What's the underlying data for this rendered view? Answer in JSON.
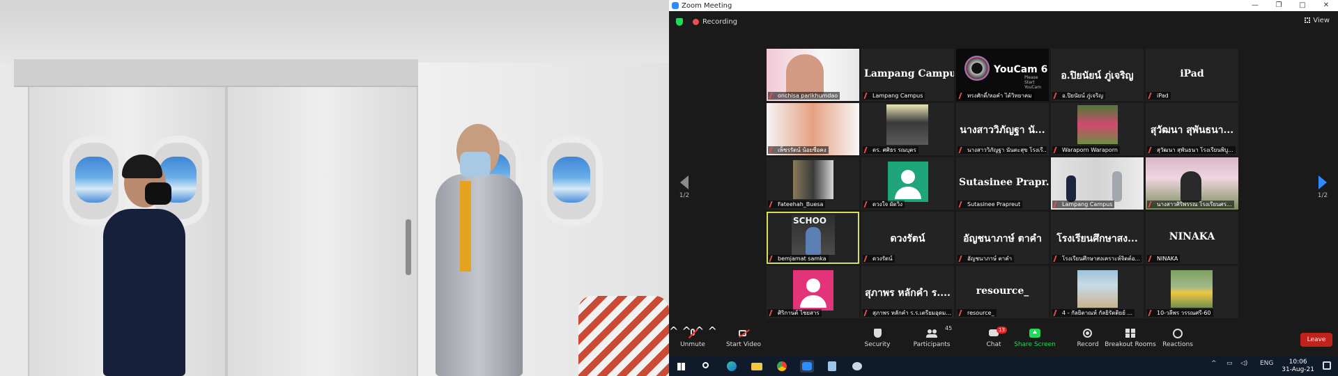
{
  "window": {
    "title": "Zoom Meeting"
  },
  "topbar": {
    "recording_label": "Recording",
    "view_label": "View"
  },
  "pager": {
    "left": "1/2",
    "right": "1/2"
  },
  "tiles": [
    {
      "name": "onchisa parikhumdao",
      "big": ""
    },
    {
      "name": "Lampang Campus",
      "big": "Lampang Campus"
    },
    {
      "name": "ทรงศักดิ์/หอคำ ไต้วิทยาคม",
      "big": ""
    },
    {
      "name": "อ.ปิยนัยน์ ภู่เจริญ",
      "big": "อ.ปิยนัยน์ ภู่เจริญ"
    },
    {
      "name": "iPad",
      "big": "iPad"
    },
    {
      "name": "เพ็ชรรัตน์ น้อยชื่อคง",
      "big": ""
    },
    {
      "name": "ดร. ศศิธร รณบุตร",
      "big": ""
    },
    {
      "name": "นางสาววิภัญฐา นันตะสุข โรงเรี...",
      "big": "นางสาววิภัญฐา นั..."
    },
    {
      "name": "Waraporn Waraporn",
      "big": ""
    },
    {
      "name": "สุวัฒนา สุพันธนา โรงเรียนพิบู...",
      "big": "สุวัฒนา สุพันธนา..."
    },
    {
      "name": "Fateehah_Buesa",
      "big": ""
    },
    {
      "name": "ดวงใจ ผัดวิง",
      "big": ""
    },
    {
      "name": "Sutasinee Prapreut",
      "big": "Sutasinee Prapr..."
    },
    {
      "name": "Lampang Campus",
      "big": ""
    },
    {
      "name": "นางสาวศิริพรรณ โรงเรียนศร...",
      "big": ""
    },
    {
      "name": "bemjamat samka",
      "big": ""
    },
    {
      "name": "ดวงรัตน์",
      "big": "ดวงรัตน์"
    },
    {
      "name": "อัญชนาภาษ์ ตาคำ",
      "big": "อัญชนาภาษ์ ตาคำ"
    },
    {
      "name": "โรงเรียนศึกษาสงเคราะห์จิตต์อ...",
      "big": "โรงเรียนศึกษาสง..."
    },
    {
      "name": "NINAKA",
      "big": "NINAKA"
    },
    {
      "name": "ศิริกานต์ ไชยสาร",
      "big": ""
    },
    {
      "name": "สุภาพร หลักคำ ร.ร.เตรียมอุดม...",
      "big": "สุภาพร หลักคำ ร...."
    },
    {
      "name": "resource_",
      "big": "resource_"
    },
    {
      "name": "4 - กัลยิตาณห์ กัลยิรัตติยย์ ...",
      "big": ""
    },
    {
      "name": "10-วลีพร วรรณศรี-60",
      "big": ""
    }
  ],
  "youcam": {
    "brand": "YouCam 6",
    "tagline": "Please Start YouCam"
  },
  "overlays": {
    "banner_text": "SCHOO"
  },
  "toolbar": {
    "unmute": "Unmute",
    "start_video": "Start Video",
    "security": "Security",
    "participants": "Participants",
    "participants_count": "45",
    "chat": "Chat",
    "chat_badge": "13",
    "share_screen": "Share Screen",
    "record": "Record",
    "breakout": "Breakout Rooms",
    "reactions": "Reactions",
    "leave": "Leave"
  },
  "taskbar": {
    "lang": "ENG",
    "time": "10:06",
    "date": "31-Aug-21"
  },
  "colors": {
    "share_green": "#23d959",
    "leave_red": "#c2221c",
    "active_speaker": "#d9e05a",
    "accent_blue": "#2d8cff"
  }
}
